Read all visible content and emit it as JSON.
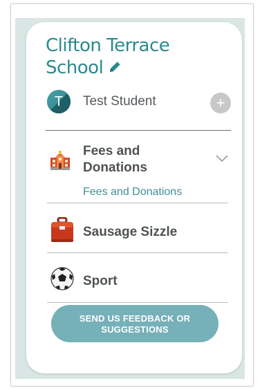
{
  "school": {
    "name": "Clifton Terrace School",
    "edit_icon": "pencil-icon"
  },
  "student": {
    "initial": "T",
    "name": "Test Student",
    "add_label": "+"
  },
  "menu": {
    "fees": {
      "label_line1": "Fees and",
      "label_line2": "Donations",
      "icon": "school-building-icon",
      "sub_items": [
        "Fees and Donations"
      ]
    },
    "sausage": {
      "label": "Sausage Sizzle",
      "icon": "lunchbox-icon"
    },
    "sport": {
      "label": "Sport",
      "icon": "soccer-ball-icon"
    }
  },
  "feedback": {
    "line1": "SEND US FEEDBACK OR",
    "line2": "SUGGESTIONS"
  },
  "colors": {
    "accent": "#2a8a8f",
    "button": "#76b0b9",
    "background": "#d9e6e4"
  }
}
